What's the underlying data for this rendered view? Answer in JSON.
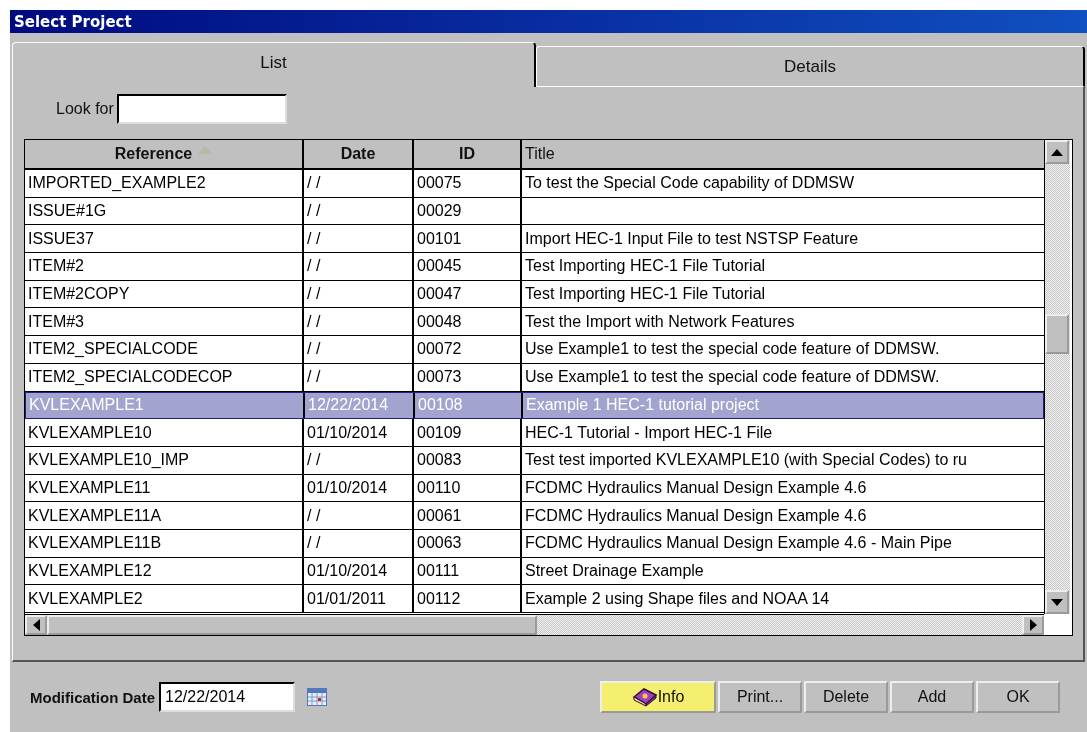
{
  "window": {
    "title": "Select Project"
  },
  "tabs": [
    {
      "label": "List",
      "selected": true
    },
    {
      "label": "Details",
      "selected": false
    }
  ],
  "search": {
    "label": "Look for"
  },
  "table": {
    "columns": [
      {
        "label": "Reference",
        "sorted": true
      },
      {
        "label": "Date",
        "sorted": false
      },
      {
        "label": "ID",
        "sorted": false
      },
      {
        "label": "Title",
        "sorted": false
      }
    ],
    "rows": [
      {
        "cells": [
          "IMPORTED_EXAMPLE2",
          "/ /",
          "00075",
          "To test the Special Code capability of DDMSW"
        ],
        "selected": false
      },
      {
        "cells": [
          "ISSUE#1G",
          "/ /",
          "00029",
          ""
        ],
        "selected": false
      },
      {
        "cells": [
          "ISSUE37",
          "/ /",
          "00101",
          "Import HEC-1 Input File to test NSTSP Feature"
        ],
        "selected": false
      },
      {
        "cells": [
          "ITEM#2",
          "/ /",
          "00045",
          "Test Importing HEC-1 File Tutorial"
        ],
        "selected": false
      },
      {
        "cells": [
          "ITEM#2COPY",
          "/ /",
          "00047",
          "Test Importing HEC-1 File Tutorial"
        ],
        "selected": false
      },
      {
        "cells": [
          "ITEM#3",
          "/ /",
          "00048",
          "Test the Import  with Network  Features"
        ],
        "selected": false
      },
      {
        "cells": [
          "ITEM2_SPECIALCODE",
          "/ /",
          "00072",
          "Use Example1 to test  the special code feature of DDMSW."
        ],
        "selected": false
      },
      {
        "cells": [
          "ITEM2_SPECIALCODECOP",
          "/ /",
          "00073",
          "Use Example1 to test  the special code feature of DDMSW."
        ],
        "selected": false
      },
      {
        "cells": [
          "KVLEXAMPLE1",
          "12/22/2014",
          "00108",
          "Example 1 HEC-1 tutorial project"
        ],
        "selected": true
      },
      {
        "cells": [
          "KVLEXAMPLE10",
          "01/10/2014",
          "00109",
          "HEC-1 Tutorial - Import HEC-1 File"
        ],
        "selected": false
      },
      {
        "cells": [
          "KVLEXAMPLE10_IMP",
          "/ /",
          "00083",
          "Test test imported KVLEXAMPLE10 (with Special Codes) to ru"
        ],
        "selected": false
      },
      {
        "cells": [
          "KVLEXAMPLE11",
          "01/10/2014",
          "00110",
          "FCDMC Hydraulics Manual Design Example 4.6"
        ],
        "selected": false
      },
      {
        "cells": [
          "KVLEXAMPLE11A",
          "/ /",
          "00061",
          "FCDMC Hydraulics Manual Design Example 4.6"
        ],
        "selected": false
      },
      {
        "cells": [
          "KVLEXAMPLE11B",
          "/ /",
          "00063",
          "FCDMC Hydraulics Manual Design Example 4.6 - Main Pipe"
        ],
        "selected": false
      },
      {
        "cells": [
          "KVLEXAMPLE12",
          "01/10/2014",
          "00111",
          "Street Drainage Example"
        ],
        "selected": false
      },
      {
        "cells": [
          "KVLEXAMPLE2",
          "01/01/2011",
          "00112",
          "Example 2 using Shape files and NOAA 14"
        ],
        "selected": false
      }
    ]
  },
  "modification_date": {
    "label": "Modification Date",
    "value": "12/22/2014"
  },
  "buttons": [
    {
      "label": "Info",
      "kind": "info"
    },
    {
      "label": "Print...",
      "kind": "plain"
    },
    {
      "label": "Delete",
      "kind": "plain"
    },
    {
      "label": "Add",
      "kind": "plain"
    },
    {
      "label": "OK",
      "kind": "plain"
    }
  ]
}
